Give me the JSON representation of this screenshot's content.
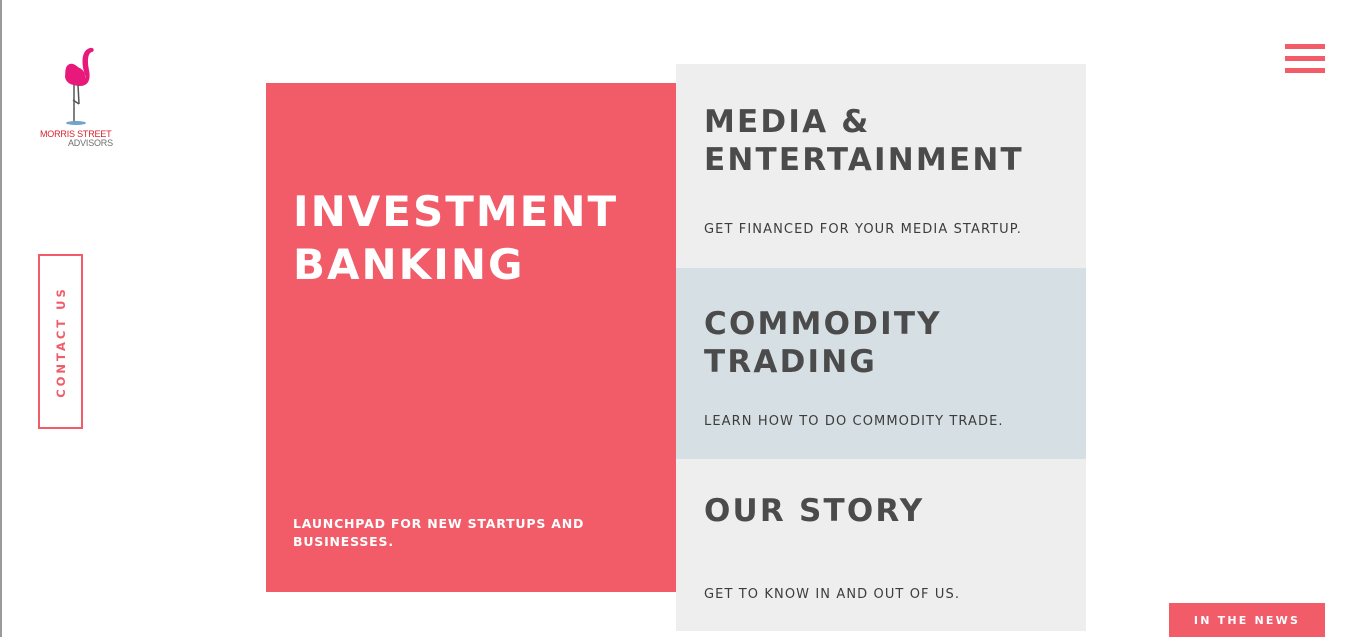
{
  "brand": {
    "logo_icon": "flamingo-icon",
    "logo_line1": "MORRIS STREET",
    "logo_line2": "ADVISORS",
    "accent_color": "#f25b68"
  },
  "contact": {
    "label": "CONTACT US"
  },
  "menu": {
    "icon": "hamburger-menu-icon"
  },
  "investment": {
    "title_line1": "INVESTMENT",
    "title_line2": "BANKING",
    "subtitle": "LAUNCHPAD FOR NEW STARTUPS AND BUSINESSES."
  },
  "panels": [
    {
      "title_line1": "MEDIA &",
      "title_line2": "ENTERTAINMENT",
      "subtitle": "GET FINANCED FOR YOUR MEDIA STARTUP.",
      "bg": "#eeeeee"
    },
    {
      "title_line1": "COMMODITY",
      "title_line2": "TRADING",
      "subtitle": "LEARN HOW TO DO COMMODITY TRADE.",
      "bg": "#d6dfe3"
    },
    {
      "title_line1": "OUR STORY",
      "subtitle": "GET TO KNOW IN AND OUT OF US.",
      "bg": "#eeeeee"
    }
  ],
  "news_button": {
    "label": "IN THE NEWS"
  }
}
